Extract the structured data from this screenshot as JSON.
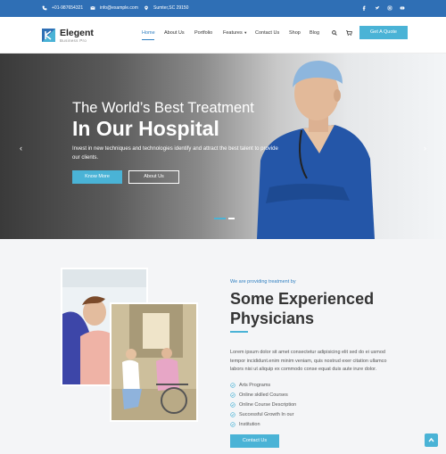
{
  "topbar": {
    "phone": "+01-987654321",
    "email": "info@example.com",
    "address": "Sumter,SC 29150",
    "social_icons": [
      "facebook-icon",
      "twitter-icon",
      "instagram-icon",
      "youtube-icon"
    ]
  },
  "header": {
    "logo_title": "Elegent",
    "logo_subtitle": "Business Pro",
    "nav": [
      "Home",
      "About Us",
      "Portfolio",
      "Features",
      "Contact Us",
      "Shop",
      "Blog"
    ],
    "quote_button": "Get A Quote"
  },
  "hero": {
    "title_line1": "The World’s Best Treatment",
    "title_line2": "In Our Hospital",
    "text": "Invest in new techniques and technologies identify and attract the best talent to provide our clients.",
    "button_primary": "Know More",
    "button_secondary": "About Us",
    "prev_arrow": "‹",
    "next_arrow": "›"
  },
  "section": {
    "eyebrow": "We are providing treatment by",
    "title_line1": "Some Experienced",
    "title_line2": "Physicians",
    "text": "Lorem ipsum dolor sit amet consectetur adipisicing elit sed do ei usmod tempor incididunt.enim minim veniam, quis nostrud exer citation ullamco labors nisi ut aliquip ex commodo conse equat duis aute irure dolor.",
    "checklist": [
      "Arts Programs",
      "Online skilled Courses",
      "Online Course Description",
      "Successful Growth In our",
      "Institution"
    ],
    "contact_button": "Contact Us"
  },
  "colors": {
    "primary": "#2f6fb5",
    "accent": "#4ab3d6",
    "link": "#2f7fc1"
  }
}
